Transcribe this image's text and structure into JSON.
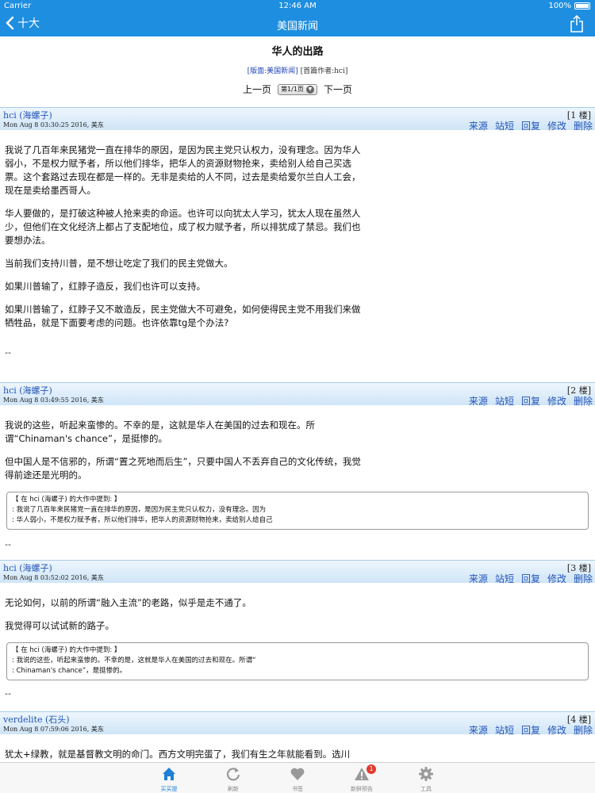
{
  "status_bar": {
    "carrier": "Carrier",
    "time": "12:46 AM",
    "battery": "100%"
  },
  "nav": {
    "back_label": "十大",
    "title": "美国新闻"
  },
  "thread": {
    "title": "华人的出路",
    "board_link": "[版面:美国新闻]",
    "first_author": "[首篇作者:hci]",
    "prev_page": "上一页",
    "page_select": "第1/1页",
    "next_page": "下一页"
  },
  "actions": {
    "source": "来源",
    "msg": "站短",
    "reply": "回复",
    "edit": "修改",
    "delete": "删除"
  },
  "posts": [
    {
      "author": "hci (海螺子)",
      "time": "Mon Aug  8 03:30:25 2016, 美东",
      "floor": "[1 楼]",
      "paragraphs": [
        "我说了几百年来民猪党一直在排华的原因，是因为民主党只认权力，没有理念。因为华人弱小，不是权力赋予者，所以他们排华，把华人的资源财物抢来，卖给别人给自己买选票。这个套路过去现在都是一样的。无非是卖给的人不同，过去是卖给爱尔兰白人工会，现在是卖给墨西哥人。",
        "华人要做的，是打破这种被人抢来卖的命运。也许可以向犹太人学习，犹太人现在虽然人少，但他们在文化经济上都占了支配地位，成了权力赋予者，所以排犹成了禁忌。我们也要想办法。",
        "当前我们支持川普，是不想让吃定了我们的民主党做大。",
        "如果川普输了，红脖子造反，我们也许可以支持。",
        "如果川普输了，红脖子又不敢造反，民主党做大不可避免，如何使得民主党不用我们来做牺牲品，就是下面要考虑的问题。也许依靠tg是个办法?"
      ],
      "sig": "--"
    },
    {
      "author": "hci (海螺子)",
      "time": "Mon Aug  8 03:49:55 2016, 美东",
      "floor": "[2 楼]",
      "paragraphs": [
        "我说的这些，听起来蛮惨的。不幸的是，这就是华人在美国的过去和现在。所谓“Chinaman's chance”，是挺惨的。",
        "但中国人是不信邪的，所谓“置之死地而后生”，只要中国人不丢弃自己的文化传统，我觉得前途还是光明的。"
      ],
      "quote": {
        "head": "【 在 hci (海螺子) 的大作中提到: 】",
        "lines": [
          ": 我说了几百年来民猪党一直在排华的原因，是因为民主党只认权力，没有理念。因为",
          ": 华人弱小，不是权力赋予者，所以他们排华，把华人的资源财物抢来，卖给别人给自己"
        ]
      },
      "sig": "--"
    },
    {
      "author": "hci (海螺子)",
      "time": "Mon Aug  8 03:52:02 2016, 美东",
      "floor": "[3 楼]",
      "paragraphs": [
        "无论如何，以前的所谓“融入主流”的老路，似乎是走不通了。",
        "我觉得可以试试新的路子。"
      ],
      "quote": {
        "head": "【 在 hci (海螺子) 的大作中提到: 】",
        "lines": [
          ": 我说的这些，听起来蛮惨的。不幸的是，这就是华人在美国的过去和现在。所谓“",
          ": Chinaman's chance”，是挺惨的。"
        ]
      },
      "sig": "--"
    },
    {
      "author": "verdelite (石头)",
      "time": "Mon Aug  8 07:59:06 2016, 美东",
      "floor": "[4 楼]",
      "paragraphs": [
        "犹太+绿教，就是基督教文明的命门。西方文明完蛋了，我们有生之年就能看到。选川"
      ]
    }
  ],
  "tabs": [
    {
      "label": "买买提",
      "icon": "home-icon"
    },
    {
      "label": "刷新",
      "icon": "refresh-icon"
    },
    {
      "label": "书签",
      "icon": "heart-icon"
    },
    {
      "label": "新鲜预告",
      "icon": "alert-icon",
      "badge": "1"
    },
    {
      "label": "工具",
      "icon": "gear-icon"
    }
  ],
  "colors": {
    "nav_bar": "#1e8ee0",
    "link": "#2455b8",
    "tab_active": "#1e7fd6",
    "badge": "#e23a2e"
  }
}
